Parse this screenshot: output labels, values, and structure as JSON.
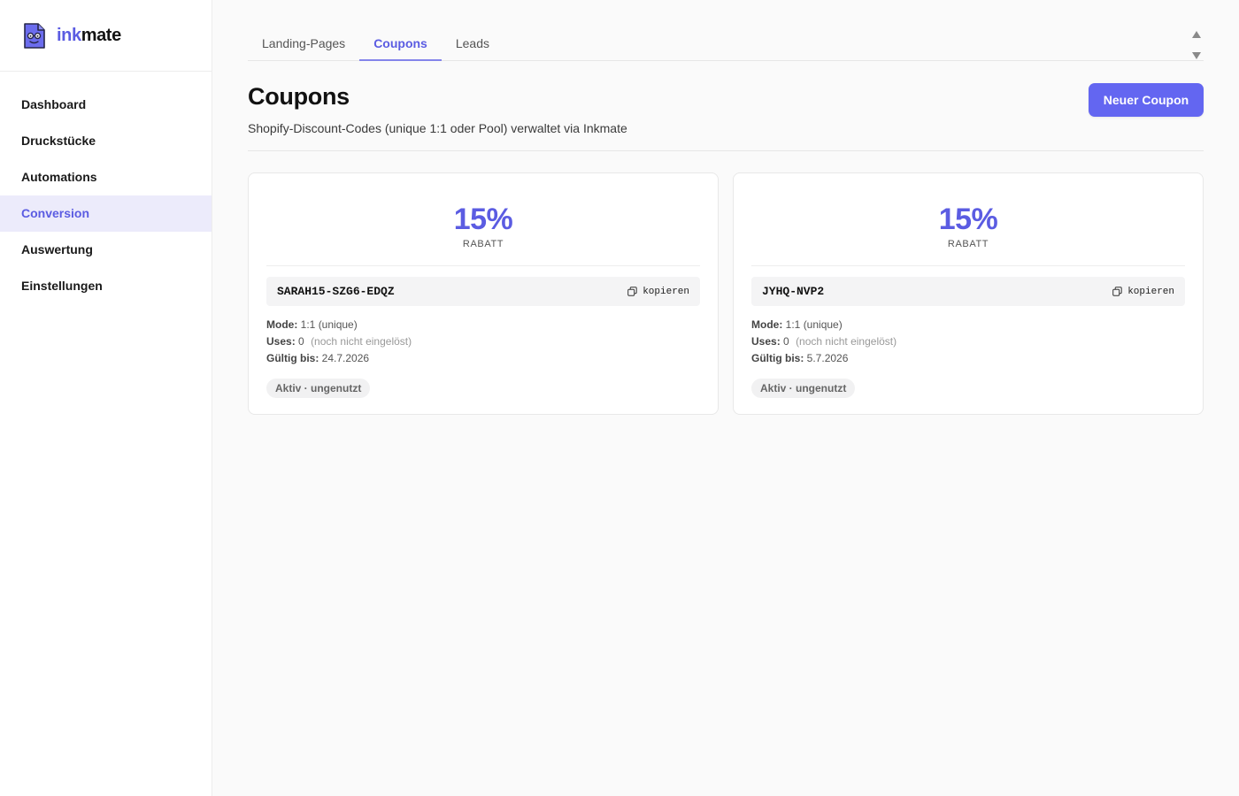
{
  "app": {
    "brand_ink": "ink",
    "brand_mate": "mate",
    "accent_color": "#5b5ce2",
    "logo_icon": "inkmate-face-icon"
  },
  "sidebar": {
    "items": [
      {
        "label": "Dashboard",
        "active": false
      },
      {
        "label": "Druckstücke",
        "active": false
      },
      {
        "label": "Automations",
        "active": false
      },
      {
        "label": "Conversion",
        "active": true
      },
      {
        "label": "Auswertung",
        "active": false
      },
      {
        "label": "Einstellungen",
        "active": false
      }
    ]
  },
  "tabs": [
    {
      "label": "Landing-Pages",
      "active": false
    },
    {
      "label": "Coupons",
      "active": true
    },
    {
      "label": "Leads",
      "active": false
    }
  ],
  "header": {
    "title": "Coupons",
    "subtitle": "Shopify-Discount-Codes (unique 1:1 oder Pool) verwaltet via Inkmate",
    "new_button_label": "Neuer Coupon"
  },
  "coupons": [
    {
      "discount": "15%",
      "discount_label": "RABATT",
      "code": "SARAH15-SZG6-EDQZ",
      "copy_label": "kopieren",
      "mode_label": "Mode:",
      "mode_value": "1:1 (unique)",
      "uses_label": "Uses:",
      "uses_value": "0",
      "uses_note": "(noch nicht eingelöst)",
      "valid_label": "Gültig bis:",
      "valid_value": "24.7.2026",
      "status": "Aktiv · ungenutzt"
    },
    {
      "discount": "15%",
      "discount_label": "RABATT",
      "code": "JYHQ-NVP2",
      "copy_label": "kopieren",
      "mode_label": "Mode:",
      "mode_value": "1:1 (unique)",
      "uses_label": "Uses:",
      "uses_value": "0",
      "uses_note": "(noch nicht eingelöst)",
      "valid_label": "Gültig bis:",
      "valid_value": "5.7.2026",
      "status": "Aktiv · ungenutzt"
    }
  ]
}
